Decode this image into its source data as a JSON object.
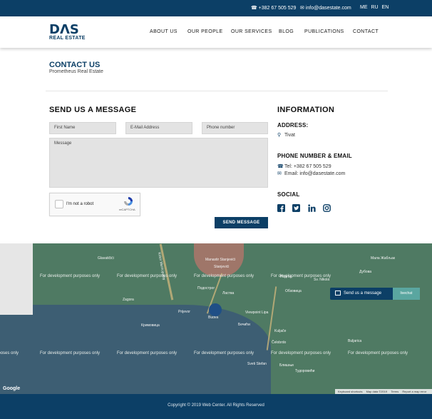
{
  "topbar": {
    "phone": "+382 67 505 529",
    "email": "info@dasestate.com",
    "languages": [
      "ME",
      "RU",
      "EN"
    ]
  },
  "logo": {
    "letters": "DΛS",
    "subtitle": "REAL ESTATE"
  },
  "nav": {
    "items": [
      "ABOUT US",
      "OUR PEOPLE",
      "OUR SERVICES",
      "BLOG",
      "PUBLICATIONS",
      "CONTACT"
    ]
  },
  "page": {
    "title": "CONTACT US",
    "subtitle": "Prometheus Real Estate"
  },
  "form": {
    "heading": "SEND US A MESSAGE",
    "first_name_placeholder": "First Name",
    "email_placeholder": "E-Mail Address",
    "phone_placeholder": "Phone number",
    "message_placeholder": "Message",
    "recaptcha_label": "I'm not a robot",
    "recaptcha_brand": "reCAPTCHA",
    "submit_label": "SEND MESSAGE"
  },
  "info": {
    "heading": "INFORMATION",
    "address_heading": "ADDRESS:",
    "address": "Tivat",
    "phone_heading": "PHONE NUMBER & EMAIL",
    "tel_line": "Tel: +382 67 505 529",
    "email_line": "Email: info@dasestate.com",
    "social_heading": "SOCIAL",
    "social_icons": [
      "facebook-icon",
      "twitter-icon",
      "linkedin-icon",
      "instagram-icon"
    ]
  },
  "map": {
    "watermark": "For development purposes only",
    "places": [
      "Glavatičići",
      "Kotor Municipality",
      "Manastir Stanjevići",
      "Stanjevići",
      "Zagora",
      "Подострог",
      "Ластва",
      "Prijevor",
      "Budva",
      "Бечићи",
      "Кримовица",
      "Kuljače",
      "Čelobrdo",
      "Sveti Stefan",
      "Блишњи",
      "Тудоровићи",
      "Подгор",
      "Обзовица",
      "Viewpoint Lipa",
      "Buljarica",
      "Sv. Nikola",
      "Дубова",
      "Мала Жабљак"
    ],
    "chat_label": "Send us a message",
    "chat_extra": "livechat",
    "google_label": "Google",
    "attribution": [
      "Keyboard shortcuts",
      "Map data ©2019",
      "Terms",
      "Report a map error"
    ]
  },
  "footer": {
    "text": "Copyright © 2019 Web Center. All Rights Reserved"
  },
  "colors": {
    "brand": "#0c3f66",
    "map_land": "#4f7a63",
    "map_water": "#3d5e73"
  }
}
